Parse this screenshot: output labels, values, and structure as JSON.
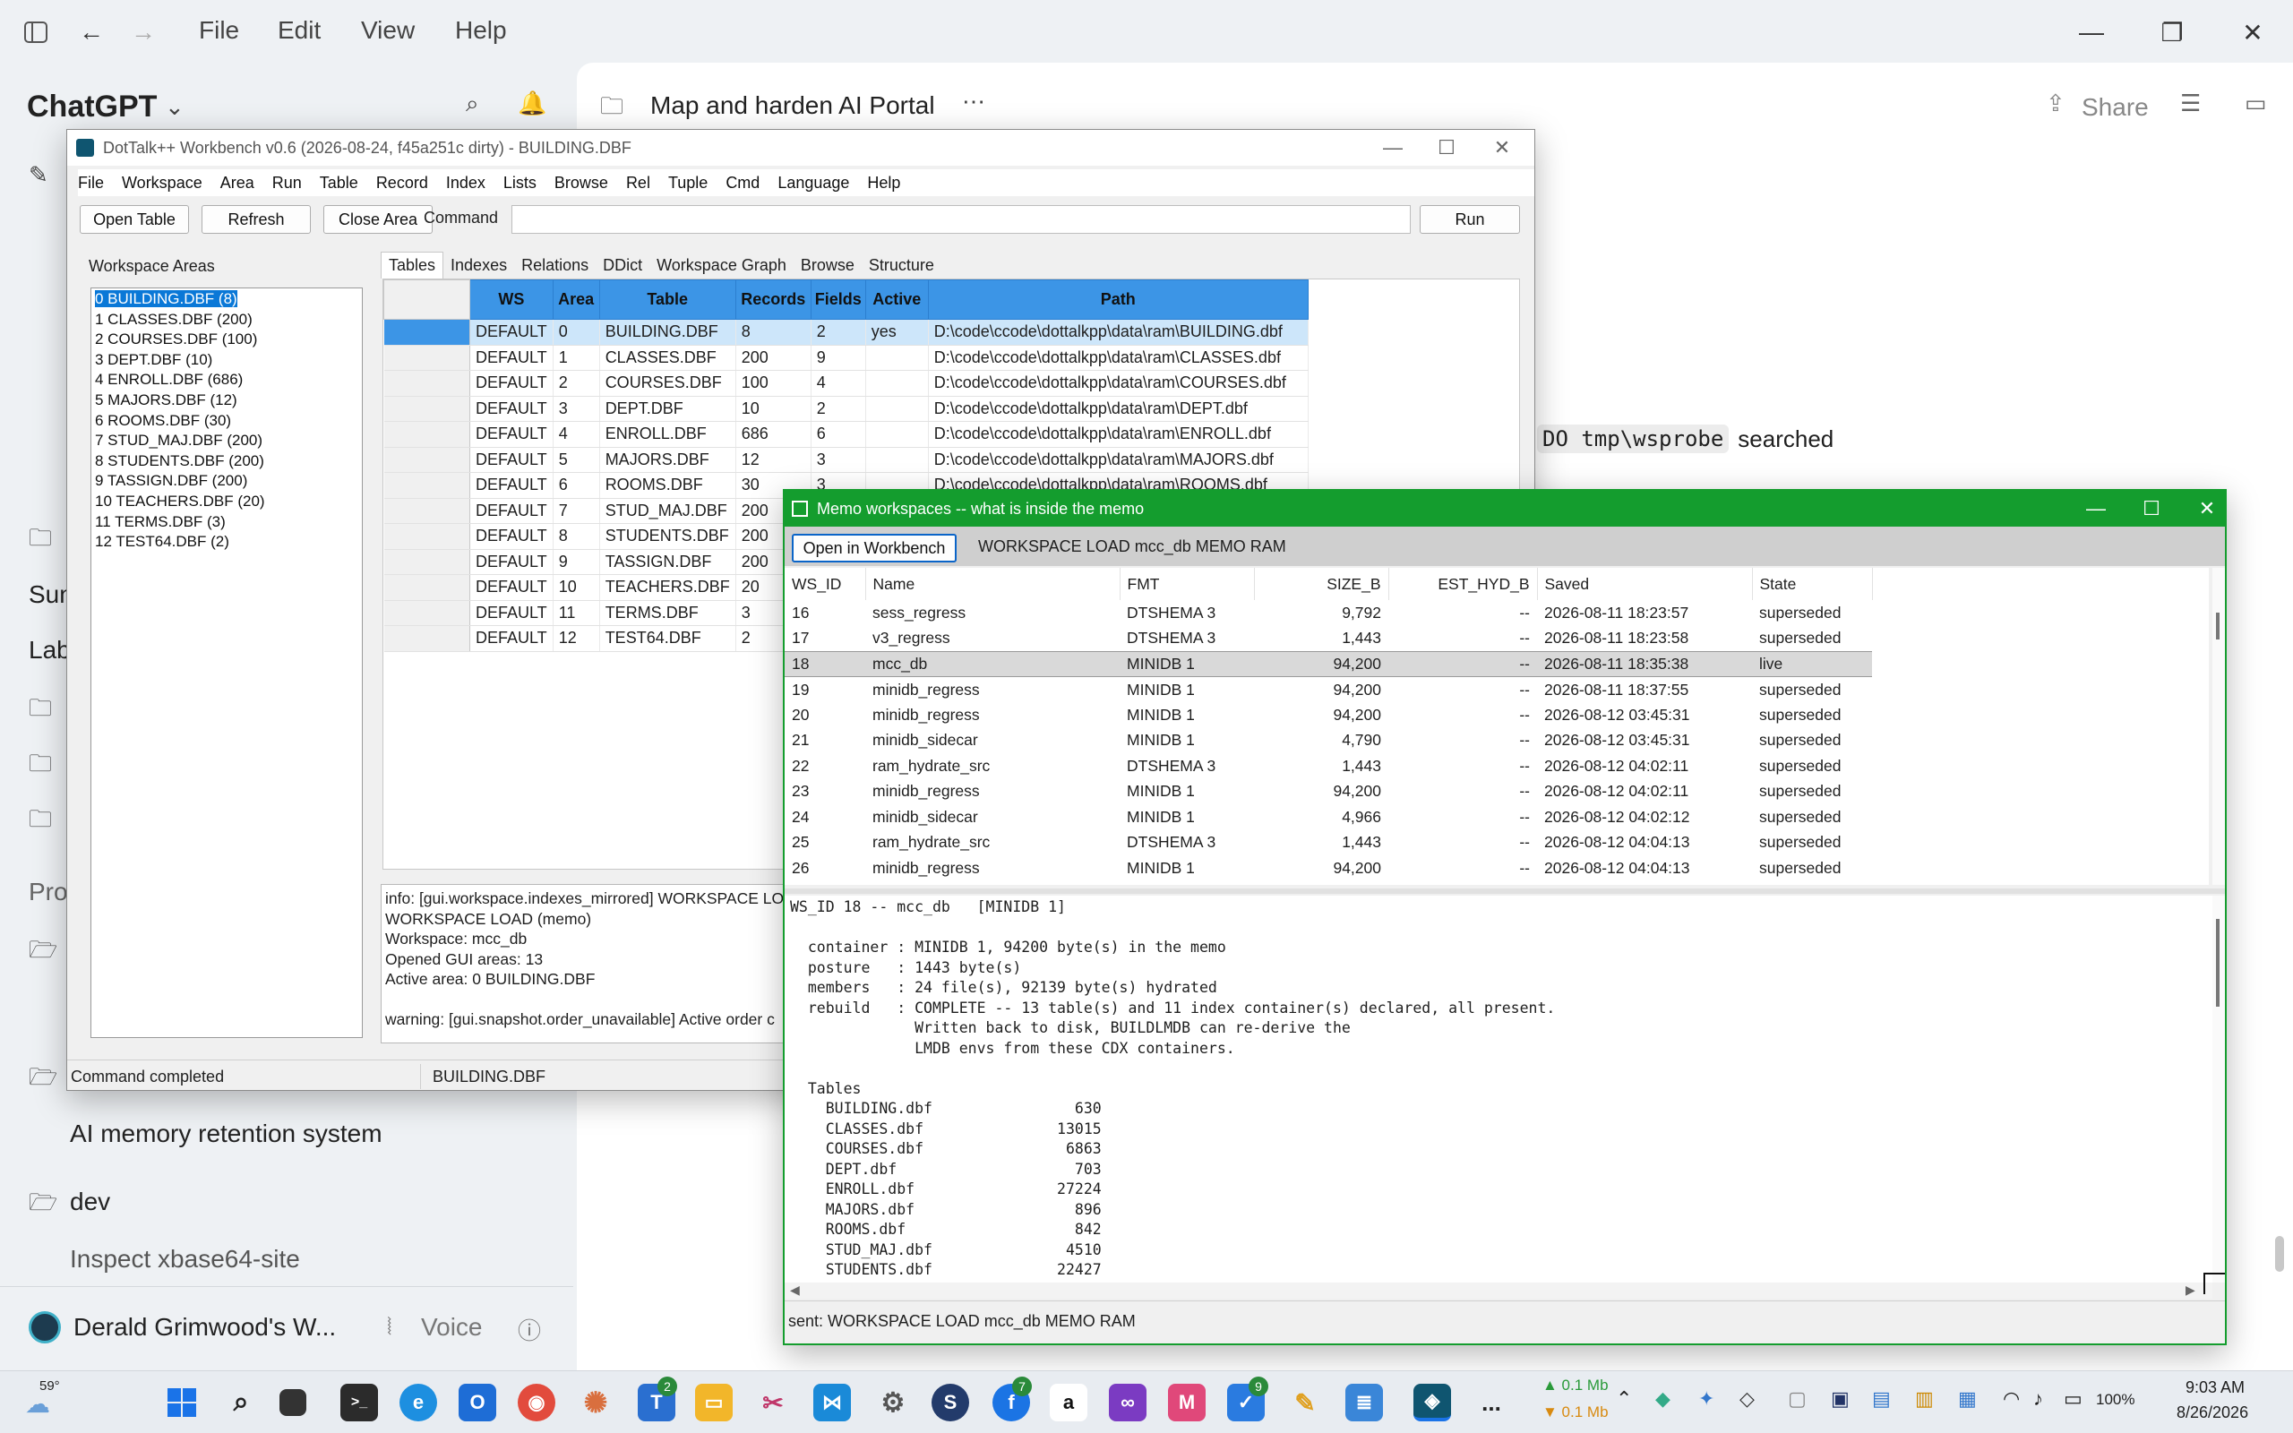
{
  "app": {
    "menu": [
      "File",
      "Edit",
      "View",
      "Help"
    ],
    "brand": "ChatGPT",
    "project_title": "Map and harden AI Portal",
    "share_label": "Share",
    "chat_snippet_code": "DO tmp\\wsprobe",
    "chat_snippet_text": "searched"
  },
  "sidebar": {
    "partial_1": "Sun",
    "partial_2": "Lab",
    "partial_3": "Pro",
    "item_ai_memory": "AI memory retention system",
    "item_dev": "dev",
    "item_inspect": "Inspect xbase64-site",
    "user_name": "Derald Grimwood's W...",
    "voice_label": "Voice"
  },
  "workbench": {
    "title": "DotTalk++ Workbench v0.6 (2026-08-24, f45a251c dirty) - BUILDING.DBF",
    "menu": [
      "File",
      "Workspace",
      "Area",
      "Run",
      "Table",
      "Record",
      "Index",
      "Lists",
      "Browse",
      "Rel",
      "Tuple",
      "Cmd",
      "Language",
      "Help"
    ],
    "toolbar": {
      "open_table": "Open Table",
      "refresh": "Refresh",
      "close_area": "Close Area",
      "command_label": "Command",
      "run": "Run"
    },
    "areas_label": "Workspace Areas",
    "areas": [
      "0  BUILDING.DBF  (8)",
      "1  CLASSES.DBF  (200)",
      "2  COURSES.DBF  (100)",
      "3  DEPT.DBF  (10)",
      "4  ENROLL.DBF  (686)",
      "5  MAJORS.DBF  (12)",
      "6  ROOMS.DBF  (30)",
      "7  STUD_MAJ.DBF  (200)",
      "8  STUDENTS.DBF  (200)",
      "9  TASSIGN.DBF  (200)",
      "10  TEACHERS.DBF  (20)",
      "11  TERMS.DBF  (3)",
      "12  TEST64.DBF  (2)"
    ],
    "tabs": [
      "Tables",
      "Indexes",
      "Relations",
      "DDict",
      "Workspace Graph",
      "Browse",
      "Structure"
    ],
    "columns": [
      "WS",
      "Area",
      "Table",
      "Records",
      "Fields",
      "Active",
      "Path"
    ],
    "rows": [
      [
        "DEFAULT",
        "0",
        "BUILDING.DBF",
        "8",
        "2",
        "yes",
        "D:\\code\\ccode\\dottalkpp\\data\\ram\\BUILDING.dbf"
      ],
      [
        "DEFAULT",
        "1",
        "CLASSES.DBF",
        "200",
        "9",
        "",
        "D:\\code\\ccode\\dottalkpp\\data\\ram\\CLASSES.dbf"
      ],
      [
        "DEFAULT",
        "2",
        "COURSES.DBF",
        "100",
        "4",
        "",
        "D:\\code\\ccode\\dottalkpp\\data\\ram\\COURSES.dbf"
      ],
      [
        "DEFAULT",
        "3",
        "DEPT.DBF",
        "10",
        "2",
        "",
        "D:\\code\\ccode\\dottalkpp\\data\\ram\\DEPT.dbf"
      ],
      [
        "DEFAULT",
        "4",
        "ENROLL.DBF",
        "686",
        "6",
        "",
        "D:\\code\\ccode\\dottalkpp\\data\\ram\\ENROLL.dbf"
      ],
      [
        "DEFAULT",
        "5",
        "MAJORS.DBF",
        "12",
        "3",
        "",
        "D:\\code\\ccode\\dottalkpp\\data\\ram\\MAJORS.dbf"
      ],
      [
        "DEFAULT",
        "6",
        "ROOMS.DBF",
        "30",
        "3",
        "",
        "D:\\code\\ccode\\dottalkpp\\data\\ram\\ROOMS.dbf"
      ],
      [
        "DEFAULT",
        "7",
        "STUD_MAJ.DBF",
        "200",
        "",
        "",
        ""
      ],
      [
        "DEFAULT",
        "8",
        "STUDENTS.DBF",
        "200",
        "",
        "",
        ""
      ],
      [
        "DEFAULT",
        "9",
        "TASSIGN.DBF",
        "200",
        "",
        "",
        ""
      ],
      [
        "DEFAULT",
        "10",
        "TEACHERS.DBF",
        "20",
        "",
        "",
        ""
      ],
      [
        "DEFAULT",
        "11",
        "TERMS.DBF",
        "3",
        "",
        "",
        ""
      ],
      [
        "DEFAULT",
        "12",
        "TEST64.DBF",
        "2",
        "",
        "",
        ""
      ]
    ],
    "log_lines": [
      "info: [gui.workspace.indexes_mirrored] WORKSPACE LOA",
      "WORKSPACE LOAD (memo)",
      "Workspace: mcc_db",
      "Opened GUI areas: 13",
      "Active area: 0  BUILDING.DBF",
      "",
      "warning: [gui.snapshot.order_unavailable] Active order c"
    ],
    "status_left": "Command completed",
    "status_right": "BUILDING.DBF"
  },
  "memo": {
    "title": "Memo workspaces -- what is inside the memo",
    "open_btn": "Open in Workbench",
    "command_text": "WORKSPACE LOAD mcc_db MEMO RAM",
    "columns": [
      "WS_ID",
      "Name",
      "FMT",
      "SIZE_B",
      "EST_HYD_B",
      "Saved",
      "State"
    ],
    "rows": [
      [
        "16",
        "sess_regress",
        "DTSHEMA 3",
        "9,792",
        "--",
        "2026-08-11 18:23:57",
        "superseded"
      ],
      [
        "17",
        "v3_regress",
        "DTSHEMA 3",
        "1,443",
        "--",
        "2026-08-11 18:23:58",
        "superseded"
      ],
      [
        "18",
        "mcc_db",
        "MINIDB 1",
        "94,200",
        "--",
        "2026-08-11 18:35:38",
        "live"
      ],
      [
        "19",
        "minidb_regress",
        "MINIDB 1",
        "94,200",
        "--",
        "2026-08-11 18:37:55",
        "superseded"
      ],
      [
        "20",
        "minidb_regress",
        "MINIDB 1",
        "94,200",
        "--",
        "2026-08-12 03:45:31",
        "superseded"
      ],
      [
        "21",
        "minidb_sidecar",
        "MINIDB 1",
        "4,790",
        "--",
        "2026-08-12 03:45:31",
        "superseded"
      ],
      [
        "22",
        "ram_hydrate_src",
        "DTSHEMA 3",
        "1,443",
        "--",
        "2026-08-12 04:02:11",
        "superseded"
      ],
      [
        "23",
        "minidb_regress",
        "MINIDB 1",
        "94,200",
        "--",
        "2026-08-12 04:02:11",
        "superseded"
      ],
      [
        "24",
        "minidb_sidecar",
        "MINIDB 1",
        "4,966",
        "--",
        "2026-08-12 04:02:12",
        "superseded"
      ],
      [
        "25",
        "ram_hydrate_src",
        "DTSHEMA 3",
        "1,443",
        "--",
        "2026-08-12 04:04:13",
        "superseded"
      ],
      [
        "26",
        "minidb_regress",
        "MINIDB 1",
        "94,200",
        "--",
        "2026-08-12 04:04:13",
        "superseded"
      ]
    ],
    "detail_lines": [
      "WS_ID 18 -- mcc_db   [MINIDB 1]",
      "",
      "  container : MINIDB 1, 94200 byte(s) in the memo",
      "  posture   : 1443 byte(s)",
      "  members   : 24 file(s), 92139 byte(s) hydrated",
      "  rebuild   : COMPLETE -- 13 table(s) and 11 index container(s) declared, all present.",
      "              Written back to disk, BUILDLMDB can re-derive the",
      "              LMDB envs from these CDX containers.",
      "",
      "  Tables",
      "    BUILDING.dbf                630",
      "    CLASSES.dbf               13015",
      "    COURSES.dbf                6863",
      "    DEPT.dbf                    703",
      "    ENROLL.dbf                27224",
      "    MAJORS.dbf                  896",
      "    ROOMS.dbf                   842",
      "    STUD_MAJ.dbf               4510",
      "    STUDENTS.dbf              22427"
    ],
    "status": "sent: WORKSPACE LOAD mcc_db MEMO RAM"
  },
  "taskbar": {
    "weather": "59°",
    "net_up": "▲ 0.1 Mb",
    "net_down": "▼ 0.1 Mb",
    "battery": "100%",
    "time": "9:03 AM",
    "date": "8/26/2026",
    "badge_2": "2",
    "badge_7": "7",
    "badge_9": "9",
    "more": "..."
  }
}
